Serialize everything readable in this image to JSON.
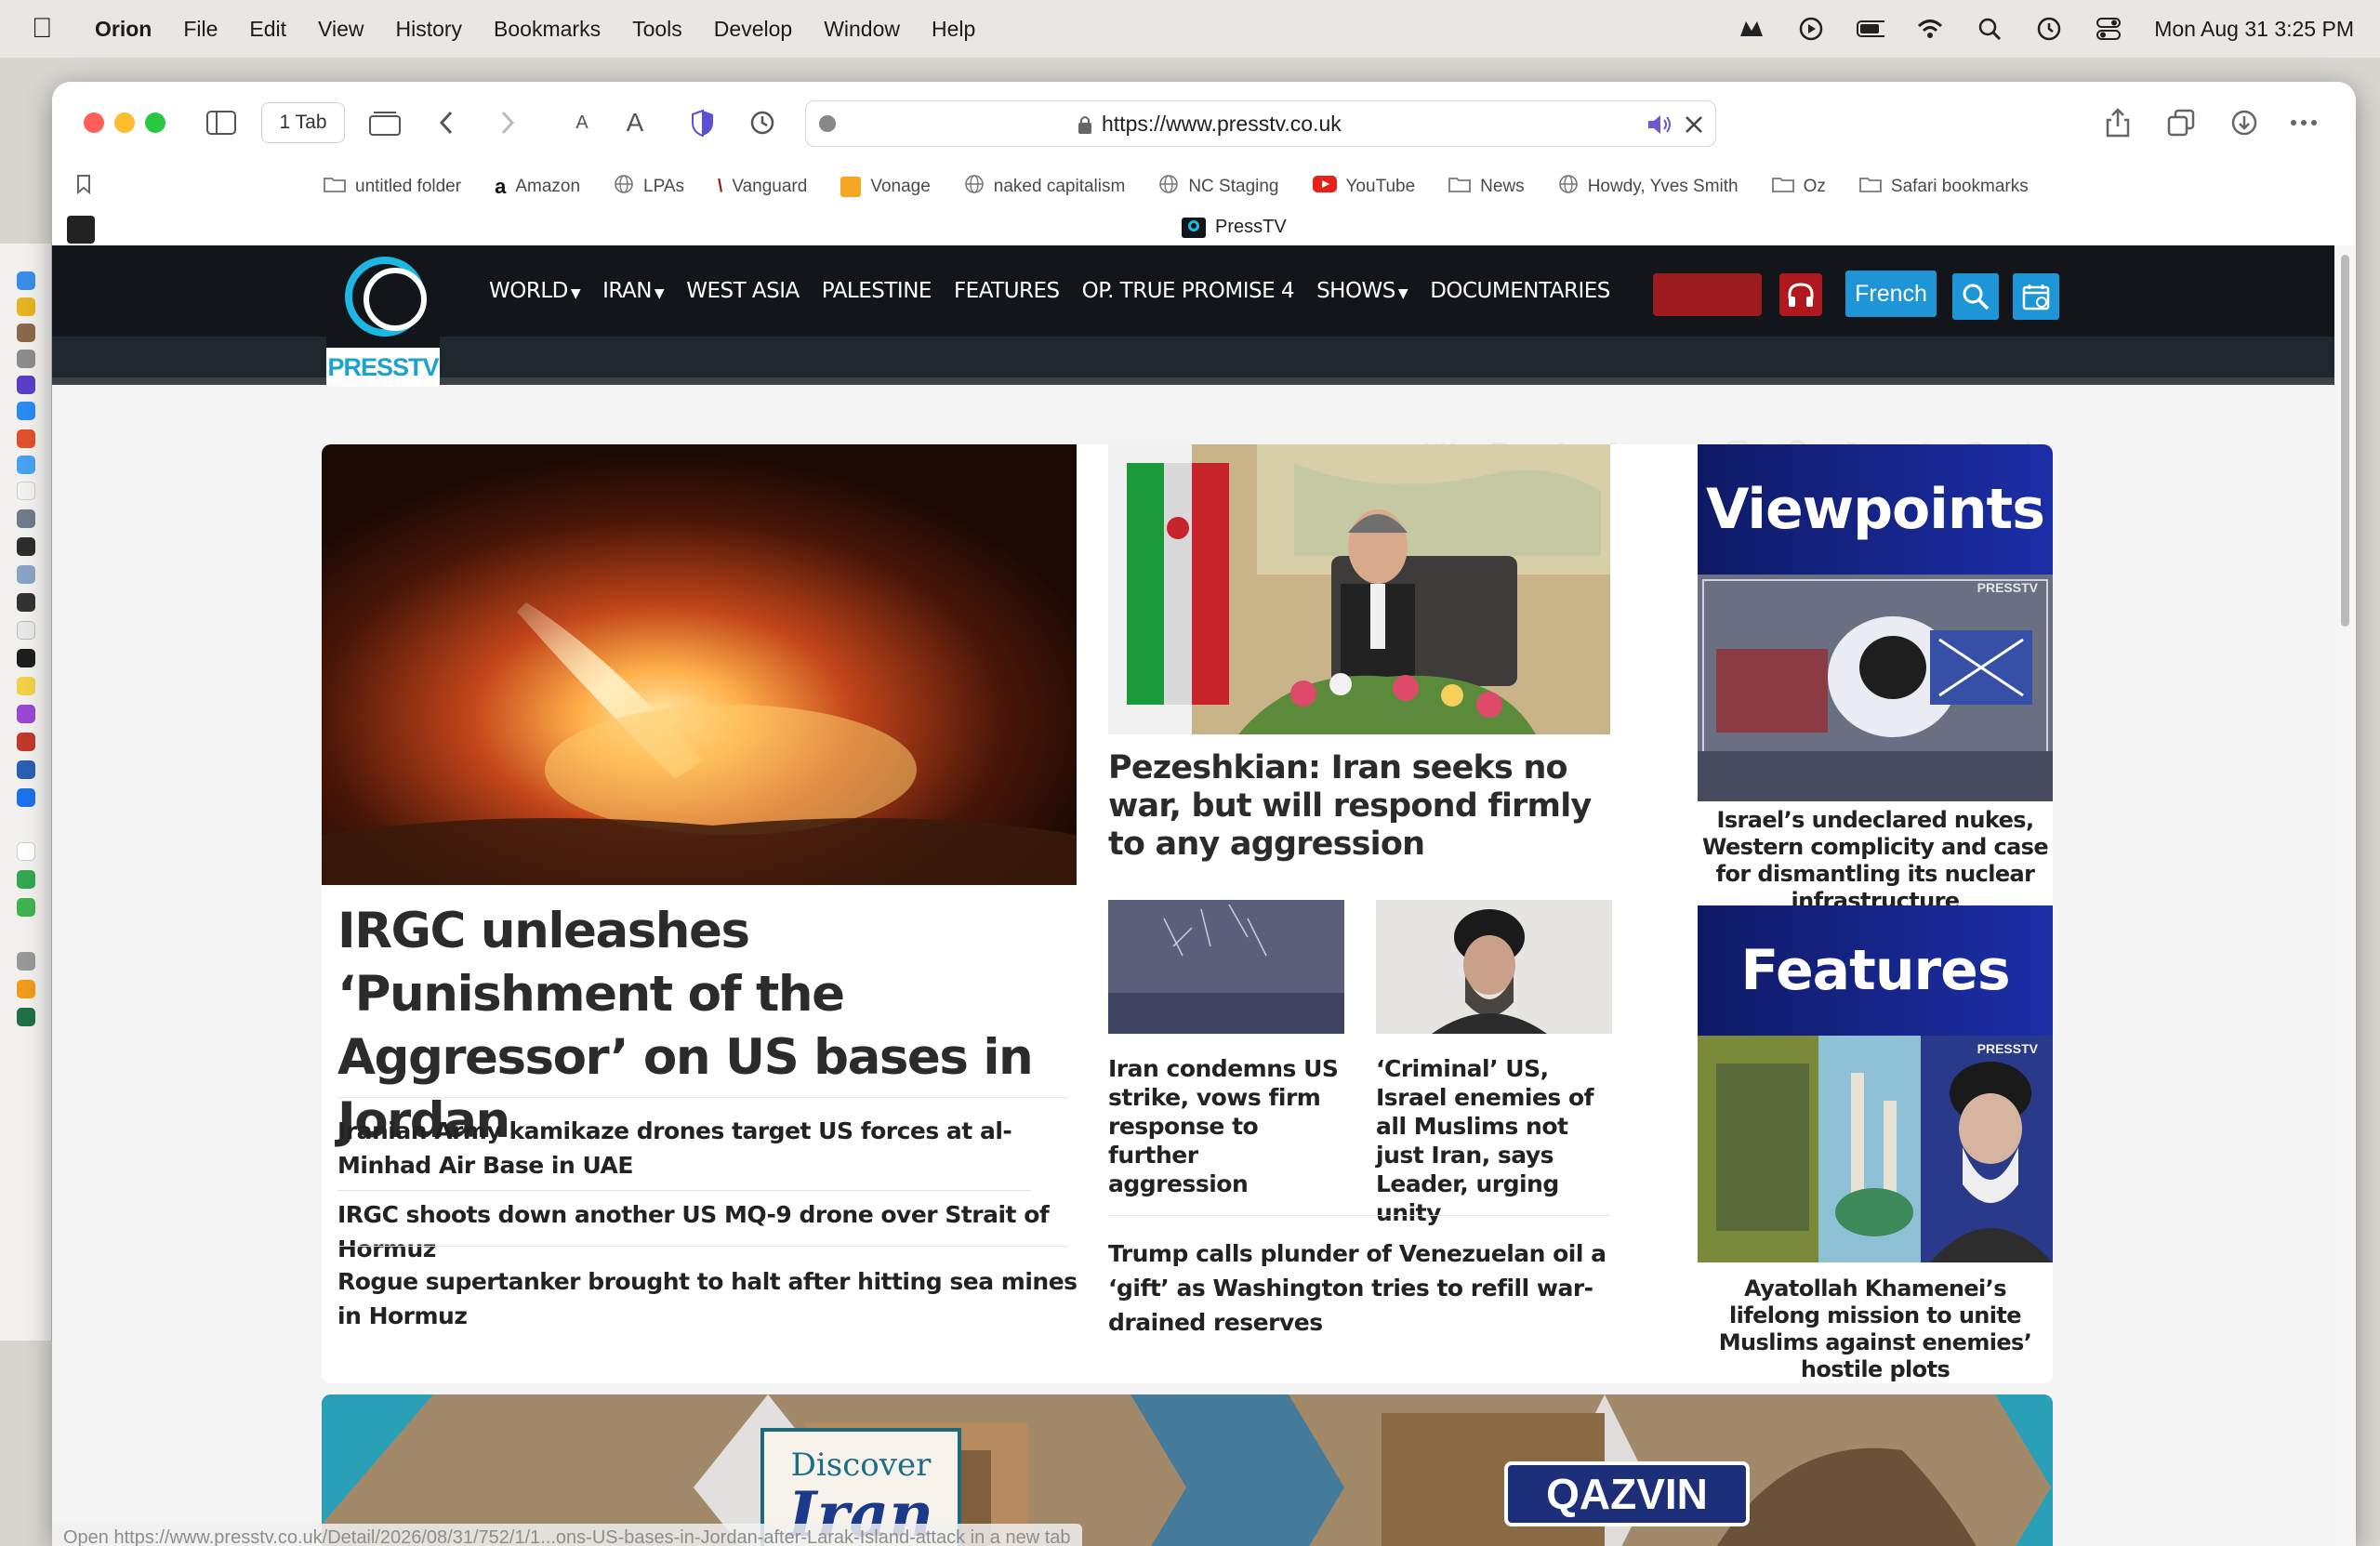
{
  "menubar": {
    "app_name": "Orion",
    "items": [
      "File",
      "Edit",
      "View",
      "History",
      "Bookmarks",
      "Tools",
      "Develop",
      "Window",
      "Help"
    ],
    "clock": "Mon Aug 31  3:25 PM"
  },
  "toolbar": {
    "tab_count": "1 Tab",
    "url": "https://www.presstv.co.uk"
  },
  "bookmarks": [
    {
      "label": "untitled folder",
      "icon": "folder-icon"
    },
    {
      "label": "Amazon",
      "icon": "amazon-icon"
    },
    {
      "label": "LPAs",
      "icon": "globe-icon"
    },
    {
      "label": "Vanguard",
      "icon": "vanguard-icon"
    },
    {
      "label": "Vonage",
      "icon": "vonage-icon"
    },
    {
      "label": "naked capitalism",
      "icon": "globe-icon"
    },
    {
      "label": "NC Staging",
      "icon": "globe-icon"
    },
    {
      "label": "YouTube",
      "icon": "youtube-icon"
    },
    {
      "label": "News",
      "icon": "folder-icon"
    },
    {
      "label": "Howdy, Yves Smith",
      "icon": "globe-icon"
    },
    {
      "label": "Oz",
      "icon": "folder-icon"
    },
    {
      "label": "Safari bookmarks",
      "icon": "folder-icon"
    }
  ],
  "tab": {
    "title": "PressTV"
  },
  "site": {
    "logo_text": "PRESSTV",
    "nav": [
      {
        "label": "WORLD",
        "dropdown": true
      },
      {
        "label": "IRAN",
        "dropdown": true
      },
      {
        "label": "WEST ASIA",
        "dropdown": false
      },
      {
        "label": "PALESTINE",
        "dropdown": false
      },
      {
        "label": "FEATURES",
        "dropdown": false
      },
      {
        "label": "OP. TRUE PROMISE 4",
        "dropdown": false
      },
      {
        "label": "SHOWS",
        "dropdown": true
      },
      {
        "label": "DOCUMENTARIES",
        "dropdown": false
      }
    ],
    "french_label": "French",
    "social_icons": [
      "vk-icon",
      "odysee-icon",
      "facebook-icon",
      "x-icon",
      "soundcloud-icon",
      "instagram-icon",
      "rumble-icon",
      "rss-icon",
      "telegram-icon",
      "bitchute-icon",
      "linkedin-icon"
    ],
    "colors": {
      "header": "#121519",
      "accent": "#1e95d6",
      "live": "#9b1b1f"
    }
  },
  "content": {
    "main_title": "IRGC unleashes ‘Punishment of the Aggressor’ on US bases in Jordan",
    "sub_headlines": [
      "Iranian Army kamikaze drones target US forces at al-Minhad Air Base in UAE",
      "IRGC shoots down another US MQ-9 drone over Strait of Hormuz",
      "Rogue supertanker brought to halt after hitting sea mines in Hormuz"
    ],
    "mid_title": "Pezeshkian: Iran seeks no war, but will respond firmly to any aggression",
    "thumb_titles": [
      "Iran condemns US strike, vows firm response to further aggression",
      "‘Criminal’ US, Israel enemies of all Muslims not just Iran, says Leader, urging unity"
    ],
    "trump_title": "Trump calls plunder of Venezuelan oil a ‘gift’ as Washington tries to refill war-drained reserves",
    "viewpoints": {
      "banner": "Viewpoints",
      "title": "Israel’s undeclared nukes, Western complicity and case for dismantling its nuclear infrastructure"
    },
    "features": {
      "banner": "Features",
      "title": "Ayatollah Khamenei’s lifelong mission to unite Muslims against enemies’ hostile plots"
    },
    "discover": {
      "discover_text": "Discover",
      "iran_text": "Iran",
      "city_label": "QAZVIN"
    },
    "watermark": "PRESSTV"
  },
  "status_bar": "Open https://www.presstv.co.uk/Detail/2026/08/31/752/1/1...ons-US-bases-in-Jordan-after-Larak-Island-attack in a new tab"
}
